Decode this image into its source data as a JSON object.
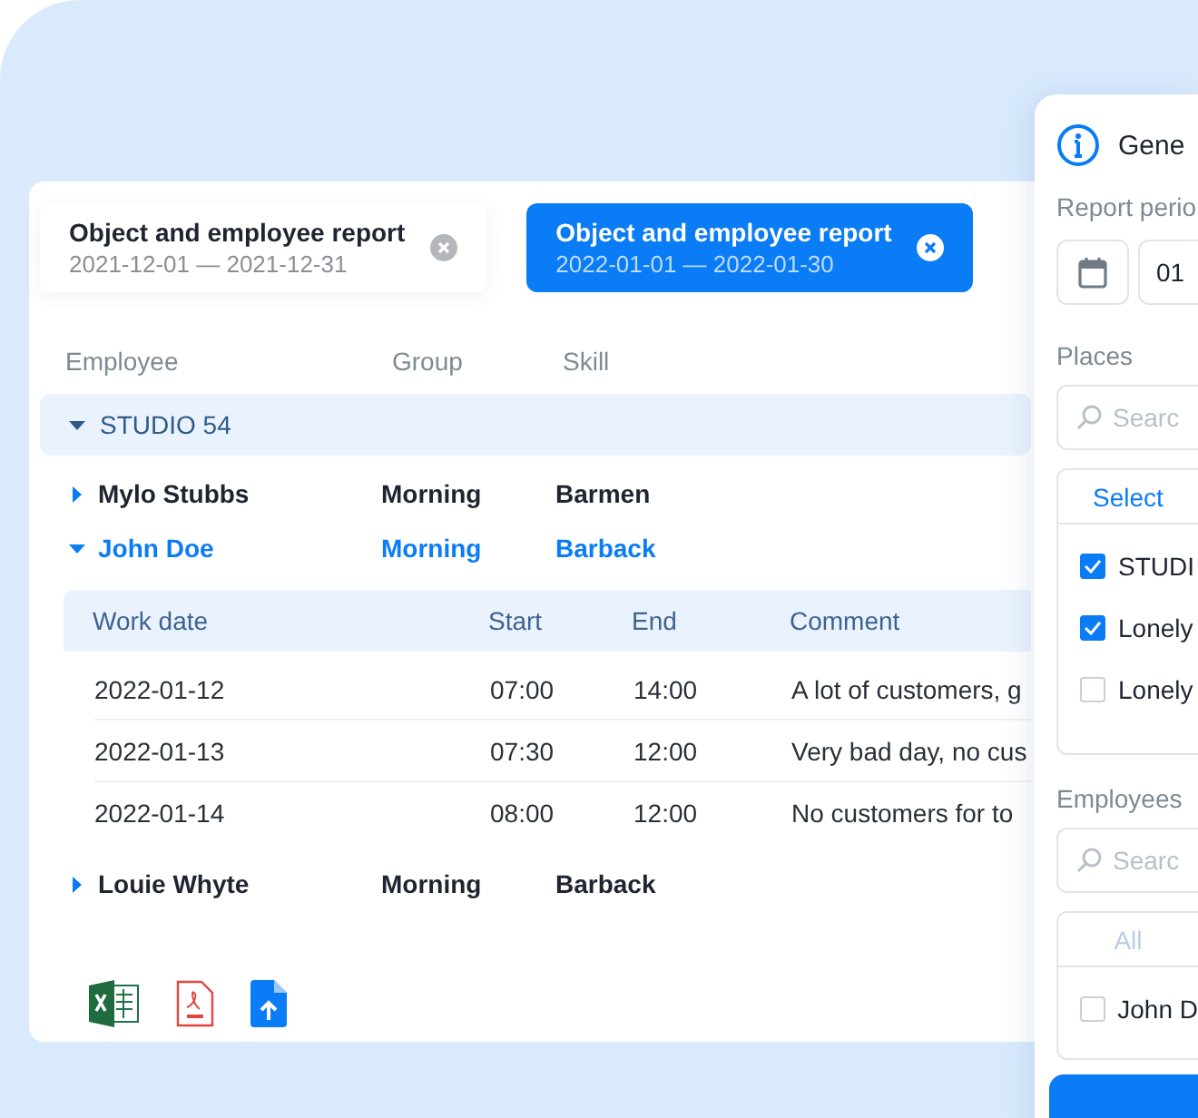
{
  "tabs": [
    {
      "title": "Object and employee report",
      "period": "2021-12-01 — 2021-12-31",
      "selected": false
    },
    {
      "title": "Object and employee report",
      "period": "2022-01-01 — 2022-01-30",
      "selected": true
    }
  ],
  "columns": [
    "Employee",
    "Group",
    "Skill"
  ],
  "groups": [
    {
      "name": "STUDIO 54",
      "expanded": true,
      "employees": [
        {
          "name": "Mylo Stubbs",
          "group": "Morning",
          "skill": "Barmen",
          "expanded": false
        },
        {
          "name": "John Doe",
          "group": "Morning",
          "skill": "Barback",
          "expanded": true,
          "detail_columns": [
            "Work date",
            "Start",
            "End",
            "Comment"
          ],
          "details": [
            {
              "date": "2022-01-12",
              "start": "07:00",
              "end": "14:00",
              "comment": "A lot of customers, g"
            },
            {
              "date": "2022-01-13",
              "start": "07:30",
              "end": "12:00",
              "comment": "Very bad day, no cus"
            },
            {
              "date": "2022-01-14",
              "start": "08:00",
              "end": "12:00",
              "comment": "No customers for to"
            }
          ]
        },
        {
          "name": "Louie Whyte",
          "group": "Morning",
          "skill": "Barback",
          "expanded": false
        }
      ]
    }
  ],
  "exports": [
    {
      "kind": "excel"
    },
    {
      "kind": "pdf"
    },
    {
      "kind": "upload"
    }
  ],
  "panel": {
    "title": "Gene",
    "period_label": "Report perio",
    "period_value": "01",
    "places": {
      "label": "Places",
      "placeholder": "Searc",
      "action": "Select",
      "action_disabled": false,
      "options": [
        {
          "label": "STUDI",
          "checked": true
        },
        {
          "label": "Lonely",
          "checked": true
        },
        {
          "label": "Lonely",
          "checked": false
        }
      ]
    },
    "employees": {
      "label": "Employees",
      "placeholder": "Searc",
      "action": "All",
      "action_disabled": true,
      "options": [
        {
          "label": "John D",
          "checked": false
        }
      ]
    }
  }
}
